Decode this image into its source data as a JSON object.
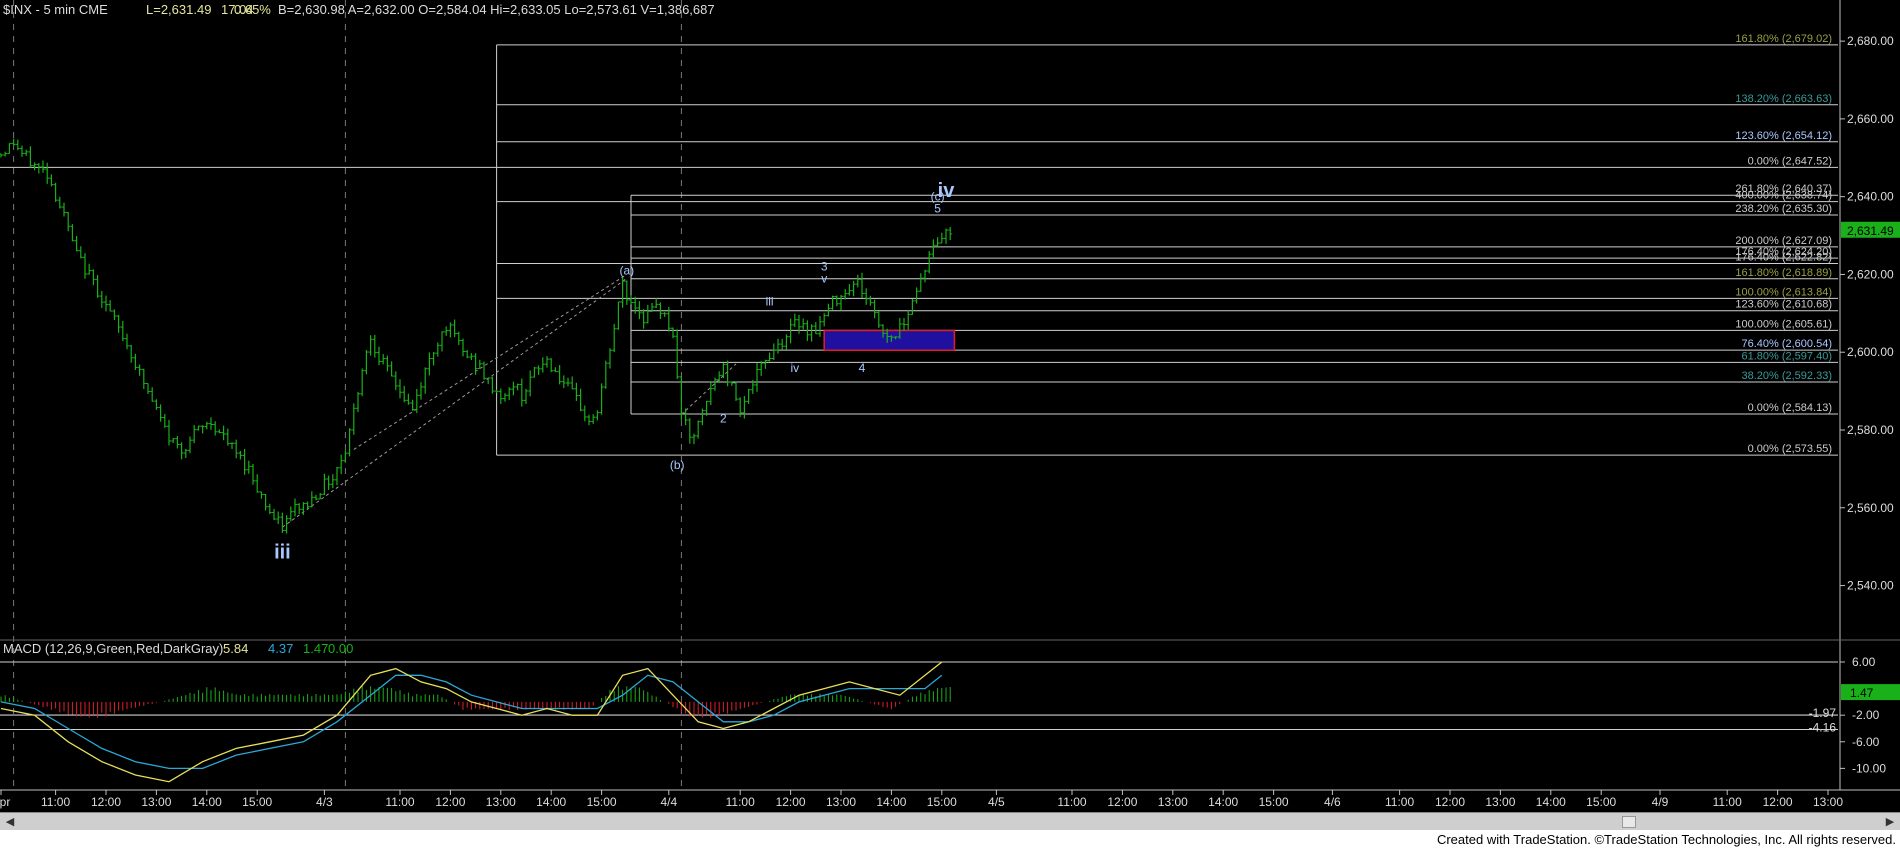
{
  "header": {
    "symbol": "$INX - 5 min  CME",
    "last": "L=2,631.49",
    "change": "17.04",
    "pct": "0.65%",
    "bar": "B=2,630.98  A=2,632.00  O=2,584.04  Hi=2,633.05  Lo=2,573.61  V=1,386,687"
  },
  "macd": {
    "title": "MACD (12,26,9,Green,Red,DarkGray)",
    "v1": "5.84",
    "v2": "4.37",
    "v3": "1.47",
    "v4": "0.00",
    "ticks": [
      {
        "v": 6,
        "t": "6.00"
      },
      {
        "v": -2,
        "t": "-2.00"
      },
      {
        "v": -6,
        "t": "-6.00"
      },
      {
        "v": -10,
        "t": "-10.00"
      }
    ],
    "level_labels": [
      {
        "v": -1.97,
        "t": "-1.97"
      },
      {
        "v": -4.16,
        "t": "-4.16"
      }
    ],
    "current": {
      "v": 1.47,
      "t": "1.47"
    }
  },
  "footer": "Created with TradeStation. ©TradeStation Technologies, Inc. All rights reserved.",
  "colors": {
    "bar": "#19b019",
    "hist_pos": "#19b019",
    "hist_neg": "#e0202a",
    "macd": "#e8e05a",
    "signal": "#2aa8d8",
    "wave": "#a8c8ff",
    "box": "#2010a0"
  },
  "chart_data": {
    "type": "bar",
    "title": "$INX - 5 min",
    "ylim": [
      2526,
      2688
    ],
    "y_ticks": [
      {
        "v": 2540,
        "t": "2,540.00"
      },
      {
        "v": 2560,
        "t": "2,560.00"
      },
      {
        "v": 2580,
        "t": "2,580.00"
      },
      {
        "v": 2600,
        "t": "2,600.00"
      },
      {
        "v": 2620,
        "t": "2,620.00"
      },
      {
        "v": 2640,
        "t": "2,640.00"
      },
      {
        "v": 2660,
        "t": "2,660.00"
      },
      {
        "v": 2680,
        "t": "2,680.00"
      }
    ],
    "last_price": {
      "v": 2631.49,
      "t": "2,631.49"
    },
    "x_ticks": [
      {
        "x": 0,
        "t": "Apr"
      },
      {
        "x": 13,
        "t": "11:00"
      },
      {
        "x": 25,
        "t": "12:00"
      },
      {
        "x": 37,
        "t": "13:00"
      },
      {
        "x": 49,
        "t": "14:00"
      },
      {
        "x": 61,
        "t": "15:00"
      },
      {
        "x": 77,
        "t": "4/3"
      },
      {
        "x": 95,
        "t": "11:00"
      },
      {
        "x": 107,
        "t": "12:00"
      },
      {
        "x": 119,
        "t": "13:00"
      },
      {
        "x": 131,
        "t": "14:00"
      },
      {
        "x": 143,
        "t": "15:00"
      },
      {
        "x": 159,
        "t": "4/4"
      },
      {
        "x": 176,
        "t": "11:00"
      },
      {
        "x": 188,
        "t": "12:00"
      },
      {
        "x": 200,
        "t": "13:00"
      },
      {
        "x": 212,
        "t": "14:00"
      },
      {
        "x": 224,
        "t": "15:00"
      },
      {
        "x": 237,
        "t": "4/5"
      },
      {
        "x": 255,
        "t": "11:00"
      },
      {
        "x": 267,
        "t": "12:00"
      },
      {
        "x": 279,
        "t": "13:00"
      },
      {
        "x": 291,
        "t": "14:00"
      },
      {
        "x": 303,
        "t": "15:00"
      },
      {
        "x": 317,
        "t": "4/6"
      },
      {
        "x": 333,
        "t": "11:00"
      },
      {
        "x": 345,
        "t": "12:00"
      },
      {
        "x": 357,
        "t": "13:00"
      },
      {
        "x": 369,
        "t": "14:00"
      },
      {
        "x": 381,
        "t": "15:00"
      },
      {
        "x": 395,
        "t": "4/9"
      },
      {
        "x": 411,
        "t": "11:00"
      },
      {
        "x": 423,
        "t": "12:00"
      },
      {
        "x": 435,
        "t": "13:00"
      }
    ],
    "day_separators": [
      3,
      82,
      162
    ],
    "price_anchors": [
      [
        0,
        2651
      ],
      [
        3,
        2654
      ],
      [
        5,
        2651
      ],
      [
        8,
        2648
      ],
      [
        11,
        2646
      ],
      [
        15,
        2635
      ],
      [
        18,
        2625
      ],
      [
        22,
        2618
      ],
      [
        26,
        2610
      ],
      [
        30,
        2602
      ],
      [
        34,
        2592
      ],
      [
        37,
        2585
      ],
      [
        40,
        2578
      ],
      [
        43,
        2575
      ],
      [
        47,
        2580
      ],
      [
        50,
        2582
      ],
      [
        53,
        2578
      ],
      [
        56,
        2574
      ],
      [
        59,
        2570
      ],
      [
        62,
        2563
      ],
      [
        65,
        2557
      ],
      [
        67,
        2555
      ],
      [
        70,
        2560
      ],
      [
        73,
        2561
      ],
      [
        76,
        2565
      ],
      [
        79,
        2568
      ],
      [
        82,
        2575
      ],
      [
        84,
        2585
      ],
      [
        86,
        2596
      ],
      [
        88,
        2604
      ],
      [
        90,
        2599
      ],
      [
        92,
        2595
      ],
      [
        94,
        2592
      ],
      [
        96,
        2588
      ],
      [
        98,
        2585
      ],
      [
        100,
        2592
      ],
      [
        102,
        2598
      ],
      [
        104,
        2603
      ],
      [
        106,
        2607
      ],
      [
        108,
        2604
      ],
      [
        110,
        2600
      ],
      [
        112,
        2598
      ],
      [
        114,
        2596
      ],
      [
        116,
        2592
      ],
      [
        118,
        2590
      ],
      [
        120,
        2588
      ],
      [
        122,
        2592
      ],
      [
        124,
        2589
      ],
      [
        126,
        2593
      ],
      [
        128,
        2596
      ],
      [
        130,
        2598
      ],
      [
        132,
        2595
      ],
      [
        134,
        2592
      ],
      [
        136,
        2589
      ],
      [
        138,
        2586
      ],
      [
        140,
        2582
      ],
      [
        142,
        2585
      ],
      [
        144,
        2596
      ],
      [
        146,
        2606
      ],
      [
        148,
        2618
      ],
      [
        149,
        2614
      ],
      [
        151,
        2612
      ],
      [
        153,
        2609
      ],
      [
        156,
        2611
      ],
      [
        158,
        2611
      ],
      [
        160,
        2603
      ],
      [
        162,
        2585
      ],
      [
        164,
        2577
      ],
      [
        166,
        2581
      ],
      [
        168,
        2587
      ],
      [
        170,
        2593
      ],
      [
        172,
        2596
      ],
      [
        174,
        2591
      ],
      [
        176,
        2586
      ],
      [
        178,
        2590
      ],
      [
        180,
        2594
      ],
      [
        182,
        2598
      ],
      [
        184,
        2601
      ],
      [
        186,
        2603
      ],
      [
        188,
        2606
      ],
      [
        190,
        2608
      ],
      [
        192,
        2606
      ],
      [
        194,
        2606
      ],
      [
        196,
        2609
      ],
      [
        198,
        2613
      ],
      [
        200,
        2615
      ],
      [
        202,
        2617
      ],
      [
        204,
        2618
      ],
      [
        206,
        2614
      ],
      [
        208,
        2610
      ],
      [
        210,
        2605
      ],
      [
        212,
        2604
      ],
      [
        214,
        2606
      ],
      [
        216,
        2611
      ],
      [
        218,
        2616
      ],
      [
        220,
        2622
      ],
      [
        222,
        2627
      ],
      [
        224,
        2630
      ],
      [
        226,
        2631
      ]
    ],
    "fib_levels": [
      {
        "v": 2679.02,
        "t": "161.80% (2,679.02)",
        "x0": 118,
        "c": "#9aa040"
      },
      {
        "v": 2663.63,
        "t": "138.20% (2,663.63)",
        "x0": 118,
        "c": "#3a9a9a"
      },
      {
        "v": 2654.12,
        "t": "123.60% (2,654.12)",
        "x0": 118,
        "c": "#a8c8ff"
      },
      {
        "v": 2647.52,
        "t": "0.00% (2,647.52)",
        "x0": -1,
        "c": "#cccccc"
      },
      {
        "v": 2640.37,
        "t": "261.80% (2,640.37)",
        "x0": 150,
        "c": "#cccccc"
      },
      {
        "v": 2638.74,
        "t": "400.00% (2,638.74)",
        "x0": 118,
        "c": "#cccccc"
      },
      {
        "v": 2635.3,
        "t": "238.20% (2,635.30)",
        "x0": 150,
        "c": "#cccccc"
      },
      {
        "v": 2627.09,
        "t": "200.00% (2,627.09)",
        "x0": 150,
        "c": "#cccccc"
      },
      {
        "v": 2624.2,
        "t": "176.40% (2,624.20)",
        "x0": 150,
        "c": "#cccccc"
      },
      {
        "v": 2622.82,
        "t": "176.40% (2,622.82)",
        "x0": 118,
        "c": "#cccccc"
      },
      {
        "v": 2618.89,
        "t": "161.80% (2,618.89)",
        "x0": 150,
        "c": "#9aa040"
      },
      {
        "v": 2613.84,
        "t": "100.00% (2,613.84)",
        "x0": 118,
        "c": "#9aa040"
      },
      {
        "v": 2610.68,
        "t": "123.60% (2,610.68)",
        "x0": 150,
        "c": "#cccccc"
      },
      {
        "v": 2605.61,
        "t": "100.00% (2,605.61)",
        "x0": 150,
        "c": "#cccccc"
      },
      {
        "v": 2600.54,
        "t": "76.40% (2,600.54)",
        "x0": 150,
        "c": "#a8c8ff"
      },
      {
        "v": 2597.4,
        "t": "61.80% (2,597.40)",
        "x0": 150,
        "c": "#3a9a9a"
      },
      {
        "v": 2592.33,
        "t": "38.20% (2,592.33)",
        "x0": 150,
        "c": "#3a9a9a"
      },
      {
        "v": 2584.13,
        "t": "0.00% (2,584.13)",
        "x0": 150,
        "c": "#cccccc"
      },
      {
        "v": 2573.55,
        "t": "0.00% (2,573.55)",
        "x0": 118,
        "c": "#cccccc"
      }
    ],
    "wave_labels": [
      {
        "t": "iii",
        "x": 67,
        "v": 2550,
        "big": true
      },
      {
        "t": "(a)",
        "x": 149,
        "v": 2621,
        "big": false
      },
      {
        "t": "(b)",
        "x": 161,
        "v": 2571,
        "big": false
      },
      {
        "t": "2",
        "x": 172,
        "v": 2583,
        "big": false
      },
      {
        "t": "iii",
        "x": 183,
        "v": 2613,
        "big": false
      },
      {
        "t": "iv",
        "x": 189,
        "v": 2596,
        "big": false
      },
      {
        "t": "3",
        "x": 196,
        "v": 2622,
        "big": false
      },
      {
        "t": "v",
        "x": 196,
        "v": 2619,
        "big": false
      },
      {
        "t": "4",
        "x": 205,
        "v": 2596,
        "big": false
      },
      {
        "t": "5",
        "x": 223,
        "v": 2637,
        "big": false
      },
      {
        "t": "(c)",
        "x": 223,
        "v": 2640,
        "big": false
      },
      {
        "t": "iv",
        "x": 225,
        "v": 2643,
        "big": true
      }
    ],
    "target_box": {
      "x0": 196,
      "x1": 227,
      "v0": 2605.6,
      "v1": 2600.5
    },
    "series": [
      {
        "name": "MACD",
        "points": [
          [
            0,
            -1
          ],
          [
            8,
            -2
          ],
          [
            16,
            -6
          ],
          [
            24,
            -9
          ],
          [
            32,
            -11
          ],
          [
            40,
            -12
          ],
          [
            48,
            -9
          ],
          [
            56,
            -7
          ],
          [
            64,
            -6
          ],
          [
            72,
            -5
          ],
          [
            80,
            -2
          ],
          [
            88,
            4
          ],
          [
            94,
            5
          ],
          [
            100,
            3
          ],
          [
            106,
            2
          ],
          [
            112,
            0
          ],
          [
            118,
            -1
          ],
          [
            124,
            -2
          ],
          [
            130,
            -1
          ],
          [
            136,
            -2
          ],
          [
            142,
            -2
          ],
          [
            148,
            4
          ],
          [
            154,
            5
          ],
          [
            160,
            1
          ],
          [
            166,
            -3
          ],
          [
            172,
            -4
          ],
          [
            178,
            -3
          ],
          [
            184,
            -1
          ],
          [
            190,
            1
          ],
          [
            196,
            2
          ],
          [
            202,
            3
          ],
          [
            208,
            2
          ],
          [
            214,
            1
          ],
          [
            220,
            4
          ],
          [
            224,
            6
          ]
        ]
      },
      {
        "name": "Signal",
        "points": [
          [
            0,
            0
          ],
          [
            8,
            -1
          ],
          [
            16,
            -4
          ],
          [
            24,
            -7
          ],
          [
            32,
            -9
          ],
          [
            40,
            -10
          ],
          [
            48,
            -10
          ],
          [
            56,
            -8
          ],
          [
            64,
            -7
          ],
          [
            72,
            -6
          ],
          [
            80,
            -3
          ],
          [
            88,
            1
          ],
          [
            94,
            4
          ],
          [
            100,
            4
          ],
          [
            106,
            3
          ],
          [
            112,
            1
          ],
          [
            118,
            0
          ],
          [
            124,
            -1
          ],
          [
            130,
            -1
          ],
          [
            136,
            -1
          ],
          [
            142,
            -1
          ],
          [
            148,
            1
          ],
          [
            154,
            4
          ],
          [
            160,
            3
          ],
          [
            166,
            0
          ],
          [
            172,
            -3
          ],
          [
            178,
            -3
          ],
          [
            184,
            -2
          ],
          [
            190,
            0
          ],
          [
            196,
            1
          ],
          [
            202,
            2
          ],
          [
            208,
            2
          ],
          [
            214,
            2
          ],
          [
            220,
            2
          ],
          [
            224,
            4
          ]
        ]
      },
      {
        "name": "Histogram",
        "points": [
          [
            0,
            1
          ],
          [
            6,
            0
          ],
          [
            12,
            -1
          ],
          [
            18,
            -2
          ],
          [
            24,
            -2
          ],
          [
            30,
            -1
          ],
          [
            38,
            0
          ],
          [
            44,
            1
          ],
          [
            50,
            2
          ],
          [
            56,
            1
          ],
          [
            62,
            1
          ],
          [
            68,
            1
          ],
          [
            74,
            1
          ],
          [
            80,
            1
          ],
          [
            86,
            2
          ],
          [
            92,
            2
          ],
          [
            98,
            1
          ],
          [
            104,
            1
          ],
          [
            110,
            -1
          ],
          [
            116,
            -1
          ],
          [
            122,
            -1
          ],
          [
            128,
            -1
          ],
          [
            134,
            -1
          ],
          [
            140,
            -1
          ],
          [
            146,
            2
          ],
          [
            152,
            2
          ],
          [
            158,
            0
          ],
          [
            164,
            -2
          ],
          [
            170,
            -2
          ],
          [
            176,
            -1
          ],
          [
            182,
            0
          ],
          [
            188,
            1
          ],
          [
            194,
            1
          ],
          [
            200,
            1
          ],
          [
            206,
            0
          ],
          [
            212,
            -1
          ],
          [
            218,
            1
          ],
          [
            224,
            2
          ]
        ]
      }
    ]
  }
}
